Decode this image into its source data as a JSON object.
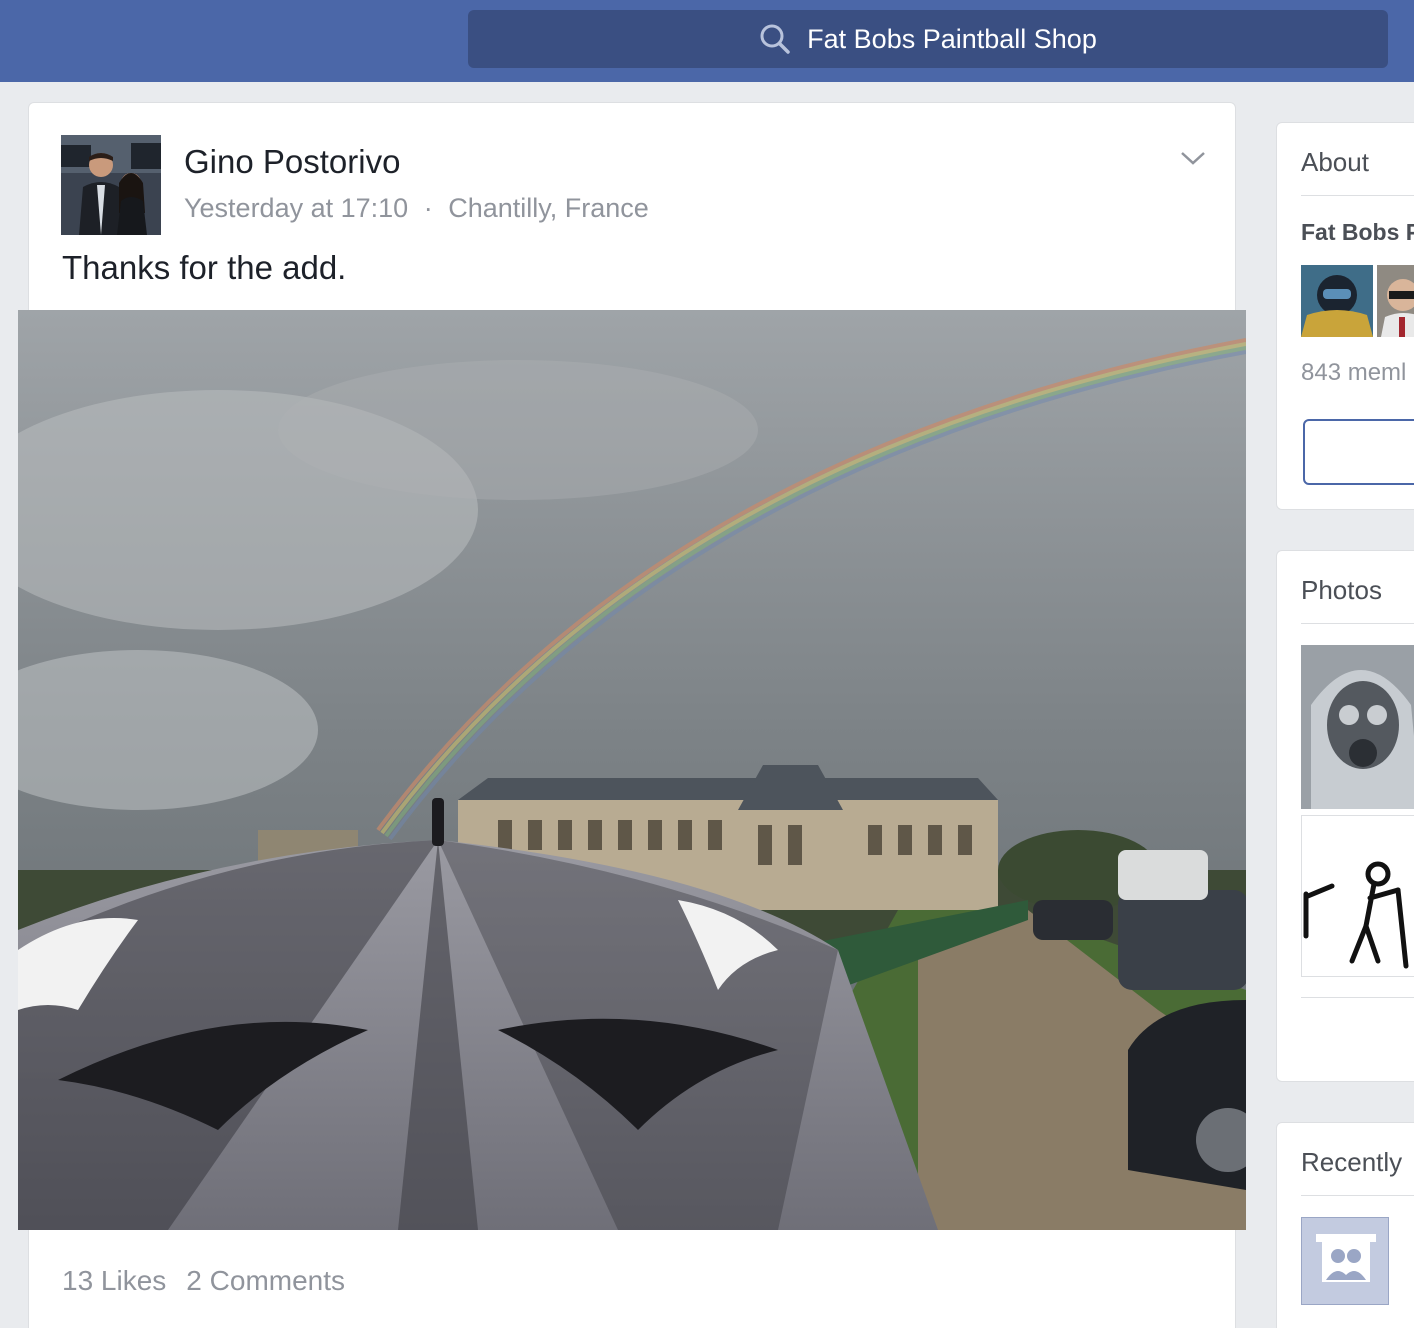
{
  "topbar": {
    "search_text": "Fat Bobs Paintball Shop",
    "icon": "search-icon",
    "background_color": "#4b67a8"
  },
  "post": {
    "author": "Gino Postorivo",
    "timestamp": "Yesterday at 17:10",
    "separator": "·",
    "location": "Chantilly, France",
    "text": "Thanks for the add.",
    "likes": "13 Likes",
    "comments": "2 Comments",
    "menu_icon": "chevron-down-icon"
  },
  "sidebar": {
    "about": {
      "title": "About",
      "group_name": "Fat Bobs P",
      "members": "843 meml"
    },
    "photos": {
      "title": "Photos"
    },
    "recent": {
      "title": "Recently",
      "icon": "group-placeholder-icon"
    }
  }
}
